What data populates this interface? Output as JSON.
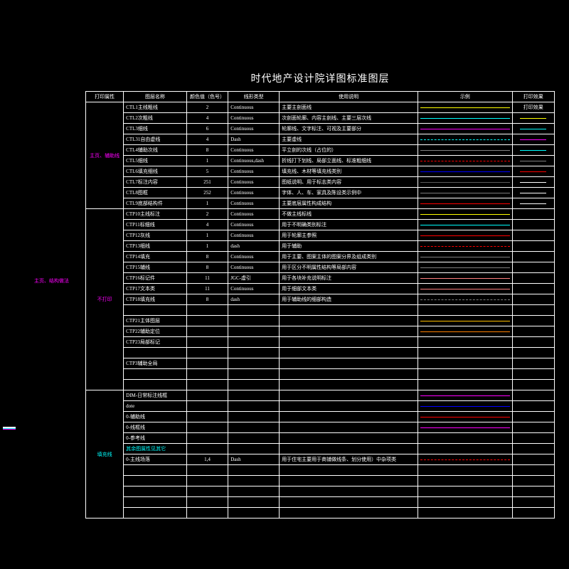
{
  "title": "时代地产设计院详图标准图层",
  "side_label": "主页、结构做法",
  "headers": {
    "print_prop": "打印属性",
    "layer_name": "图层名称",
    "color": "颜色值（色号）",
    "linetype": "线形类型",
    "usage": "使用说明",
    "sample": "示例",
    "print_eff": "打印效果"
  },
  "groups": [
    {
      "label": "主页、辅助线",
      "label_color": "#ff00ff",
      "rows": [
        {
          "layer": "CTL1主线粗线",
          "color": "2",
          "ltype": "Continuous",
          "usage": "主要主剖面线",
          "sc": "#ffff00",
          "pe": "打印效果"
        },
        {
          "layer": "CTL2次粗线",
          "color": "4",
          "ltype": "Continuous",
          "usage": "次剖面轮廓、内容主剖线、主要三层次线",
          "sc": "#00ffff"
        },
        {
          "layer": "CTL3细线",
          "color": "6",
          "ltype": "Continuous",
          "usage": "轮廓线、文字标注、可视及主要部分",
          "sc": "#ff00ff"
        },
        {
          "layer": "CTL31自由虚线",
          "color": "4",
          "ltype": "Dash",
          "usage": "主要虚线",
          "sc": "#00ffff"
        },
        {
          "layer": "CTL4辅助次线",
          "color": "8",
          "ltype": "Continuous",
          "usage": "平立剖的次线（占位的）",
          "sc": "#808080"
        },
        {
          "layer": "CTL5细线",
          "color": "1",
          "ltype": "Continuous,dash",
          "usage": "折线打下划线、局部立面线、标准粗细线",
          "sc": "#ff0000"
        },
        {
          "layer": "CTL6填充细线",
          "color": "5",
          "ltype": "Continuous",
          "usage": "填充线、木材等填充线类别",
          "sc": "#0000ff"
        },
        {
          "layer": "CTL7标注内容",
          "color": "251",
          "ltype": "Continuous",
          "usage": "图纸说明、用于标志类内容",
          "sc": "#5b5b5b"
        },
        {
          "layer": "CTL8图框",
          "color": "252",
          "ltype": "Continuous",
          "usage": "字体、人、车、家具及陈设类示例中",
          "sc": "#7d7d7d"
        },
        {
          "layer": "CTL9底部结构件",
          "color": "1",
          "ltype": "Continuous",
          "usage": "主要底层属性构成结构",
          "sc": "#ff0000"
        }
      ]
    },
    {
      "label": "不打印",
      "label_color": "#ff00ff",
      "rows": [
        {
          "layer": "CTP10主线标注",
          "color": "2",
          "ltype": "Continuous",
          "usage": "不做主线标线",
          "sc": "#ffff00"
        },
        {
          "layer": "CTP11标细线",
          "color": "4",
          "ltype": "Continuous",
          "usage": "用于不明确类别标注",
          "sc": "#00ffff"
        },
        {
          "layer": "CTP12灰线",
          "color": "1",
          "ltype": "Continuous",
          "usage": "用于轮廓主参照",
          "sc": "#ff0000"
        },
        {
          "layer": "CTP13细线",
          "color": "1",
          "ltype": "dash",
          "usage": "用于辅助",
          "sc": "#ff0000"
        },
        {
          "layer": "CTP14填充",
          "color": "8",
          "ltype": "Continuous",
          "usage": "用于主要、图案主体的图案分界及组成类别",
          "sc": "#808080"
        },
        {
          "layer": "CTP15辅线",
          "color": "8",
          "ltype": "Continuous",
          "usage": "用于区分不明属性结构等局部内容",
          "sc": "#808080"
        },
        {
          "layer": "CTP16标记件",
          "color": "11",
          "ltype": "JGC-虚引",
          "usage": "用于各块补充说明标注",
          "sc": "#ff7f7f"
        },
        {
          "layer": "CTP17文本类",
          "color": "11",
          "ltype": "Continuous",
          "usage": "用于细部文本类",
          "sc": "#ff7f7f"
        },
        {
          "layer": "CTP18填充线",
          "color": "8",
          "ltype": "dash",
          "usage": "用于辅助线的细部构造",
          "sc": "#808080"
        },
        {
          "layer": "",
          "color": "",
          "ltype": "",
          "usage": "",
          "sc": ""
        },
        {
          "layer": "CTP21主体图层",
          "color": "",
          "ltype": "",
          "usage": "",
          "sc": "#ffbf00"
        },
        {
          "layer": "CTP22辅助定位",
          "color": "",
          "ltype": "",
          "usage": "",
          "sc": "#ff7f00"
        },
        {
          "layer": "CTP23局部标记",
          "color": "",
          "ltype": "",
          "usage": "",
          "sc": ""
        },
        {
          "layer": "",
          "color": "",
          "ltype": "",
          "usage": "",
          "sc": ""
        },
        {
          "layer": "CTP3辅助全局",
          "color": "",
          "ltype": "",
          "usage": "",
          "sc": ""
        },
        {
          "layer": "",
          "color": "",
          "ltype": "",
          "usage": "",
          "sc": ""
        },
        {
          "layer": "",
          "color": "",
          "ltype": "",
          "usage": "",
          "sc": ""
        }
      ]
    },
    {
      "label": "填充线",
      "label_color": "#00ffff",
      "rows": [
        {
          "layer": "DIM-日常标注线框",
          "color": "",
          "ltype": "",
          "usage": "",
          "sc": "#ff00ff"
        },
        {
          "layer": "dote",
          "color": "",
          "ltype": "",
          "usage": "",
          "sc": "#0000ff"
        },
        {
          "layer": "0-辅助线",
          "color": "",
          "ltype": "",
          "usage": "",
          "sc": "#ff0000"
        },
        {
          "layer": "0-线框线",
          "color": "",
          "ltype": "",
          "usage": "",
          "sc": "#ff00ff"
        },
        {
          "layer": "0-参考线",
          "color": "",
          "ltype": "",
          "usage": "",
          "sc": ""
        },
        {
          "layer": "其余图属性见其它",
          "color": "",
          "ltype": "",
          "usage": "",
          "sc": "",
          "lcolor": "#00ffff"
        },
        {
          "layer": "0-主线场落",
          "color": "1,4",
          "ltype": "Dash",
          "usage": "用于住宅主要用于商铺做线条、划分使用）中杂项类",
          "sc": "#ff0000"
        },
        {
          "layer": "",
          "color": "",
          "ltype": "",
          "usage": "",
          "sc": ""
        },
        {
          "layer": "",
          "color": "",
          "ltype": "",
          "usage": "",
          "sc": ""
        },
        {
          "layer": "",
          "color": "",
          "ltype": "",
          "usage": "",
          "sc": ""
        },
        {
          "layer": "",
          "color": "",
          "ltype": "",
          "usage": "",
          "sc": ""
        },
        {
          "layer": "",
          "color": "",
          "ltype": "",
          "usage": "",
          "sc": ""
        }
      ]
    }
  ],
  "print_samples": [
    {
      "c": "#ffff00"
    },
    {
      "c": "#00ffff"
    },
    {
      "c": "#ff00ff"
    },
    {
      "c": "#00ffff"
    },
    {
      "c": "#808080"
    },
    {
      "c": "#ff0000"
    },
    {
      "c": "#ffffff"
    },
    {
      "c": "#ffffff"
    },
    {
      "c": "#ffffff"
    },
    {
      "c": "#ffffff"
    }
  ],
  "legend": [
    {
      "c": "#ffffff"
    },
    {
      "c": "#ffffff"
    },
    {
      "c": "#00ffff"
    },
    {
      "c": "#ff00ff"
    }
  ]
}
